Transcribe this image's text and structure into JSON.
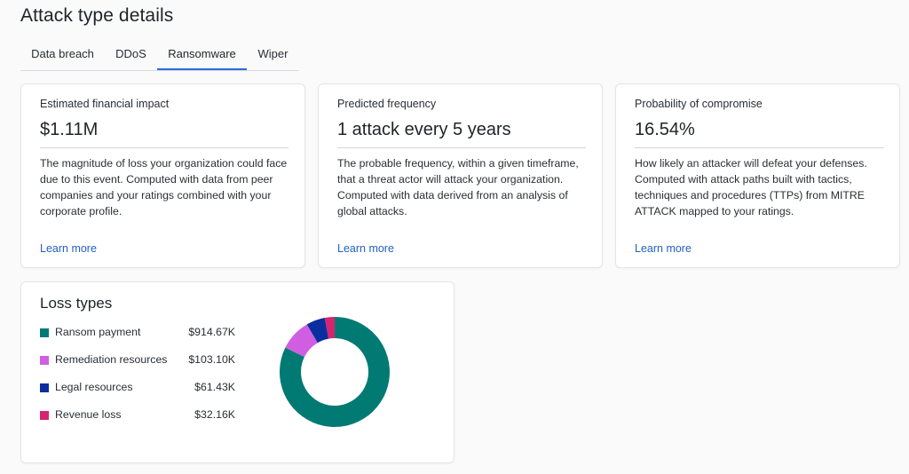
{
  "page": {
    "title": "Attack type details"
  },
  "tabs": [
    {
      "label": "Data breach"
    },
    {
      "label": "DDoS"
    },
    {
      "label": "Ransomware",
      "active": true
    },
    {
      "label": "Wiper"
    }
  ],
  "accent_color": "#2b6cd6",
  "cards": [
    {
      "label": "Estimated financial impact",
      "value": "$1.11M",
      "description": "The magnitude of loss your organization could face due to this event. Computed with data from peer companies and your ratings combined with your corporate profile.",
      "link": "Learn more"
    },
    {
      "label": "Predicted frequency",
      "value": "1 attack every 5 years",
      "description": "The probable frequency, within a given timeframe, that a threat actor will attack your organization. Computed with data derived from an analysis of global attacks.",
      "link": "Learn more"
    },
    {
      "label": "Probability of compromise",
      "value": "16.54%",
      "description": "How likely an attacker will defeat your defenses. Computed with attack paths built with tactics, techniques and procedures (TTPs) from MITRE ATTACK mapped to your ratings.",
      "link": "Learn more"
    }
  ],
  "loss": {
    "title": "Loss types",
    "items": [
      {
        "name": "Ransom payment",
        "amount": "$914.67K",
        "value": 914.67,
        "color": "#007a73"
      },
      {
        "name": "Remediation resources",
        "amount": "$103.10K",
        "value": 103.1,
        "color": "#cf5fe0"
      },
      {
        "name": "Legal resources",
        "amount": "$61.43K",
        "value": 61.43,
        "color": "#0b2e9e"
      },
      {
        "name": "Revenue loss",
        "amount": "$32.16K",
        "value": 32.16,
        "color": "#d6246e"
      }
    ]
  },
  "chart_data": {
    "type": "pie",
    "donut": true,
    "categories": [
      "Ransom payment",
      "Remediation resources",
      "Legal resources",
      "Revenue loss"
    ],
    "values": [
      914.67,
      103.1,
      61.43,
      32.16
    ]
  }
}
